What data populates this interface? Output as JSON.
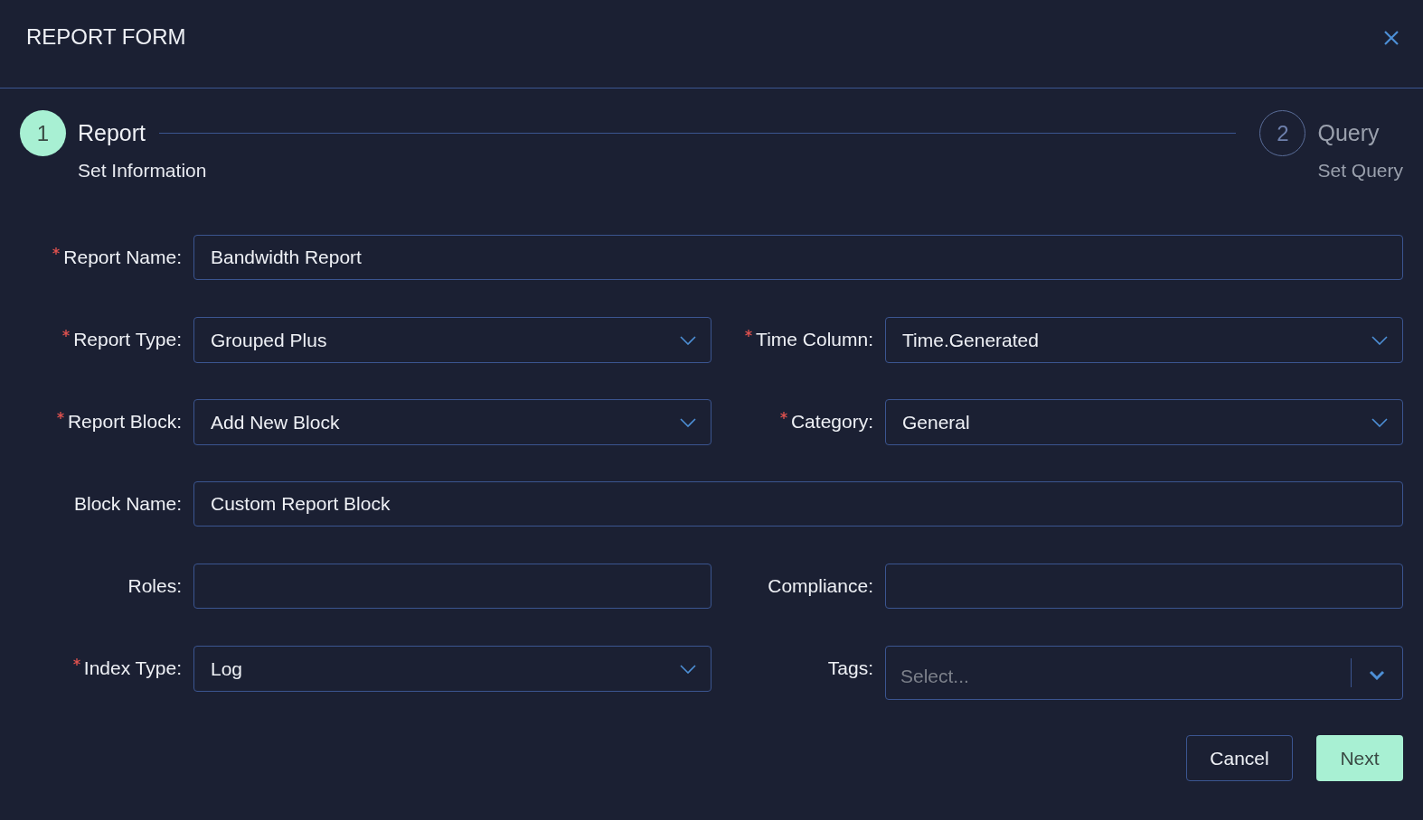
{
  "dialog": {
    "title": "REPORT FORM"
  },
  "steps": [
    {
      "number": "1",
      "title": "Report",
      "subtitle": "Set Information",
      "active": true
    },
    {
      "number": "2",
      "title": "Query",
      "subtitle": "Set Query",
      "active": false
    }
  ],
  "rows": [
    {
      "fields": [
        {
          "label": "Report Name:",
          "required": true,
          "kind": "text",
          "value": "Bandwidth Report"
        }
      ]
    },
    {
      "fields": [
        {
          "label": "Report Type:",
          "required": true,
          "kind": "select",
          "value": "Grouped Plus"
        },
        {
          "label": "Time Column:",
          "required": true,
          "kind": "select",
          "value": "Time.Generated"
        }
      ]
    },
    {
      "fields": [
        {
          "label": "Report Block:",
          "required": true,
          "kind": "select",
          "value": "Add New Block"
        },
        {
          "label": "Category:",
          "required": true,
          "kind": "select",
          "value": "General"
        }
      ]
    },
    {
      "fields": [
        {
          "label": "Block Name:",
          "required": false,
          "kind": "text",
          "value": "Custom Report Block"
        }
      ]
    },
    {
      "fields": [
        {
          "label": "Roles:",
          "required": false,
          "kind": "text"
        },
        {
          "label": "Compliance:",
          "required": false,
          "kind": "text"
        }
      ]
    },
    {
      "fields": [
        {
          "label": "Index Type:",
          "required": true,
          "kind": "select",
          "value": "Log"
        },
        {
          "label": "Tags:",
          "required": false,
          "kind": "multiselect",
          "placeholder": "Select..."
        }
      ]
    }
  ],
  "buttons": [
    {
      "label": "Cancel",
      "kind": "secondary"
    },
    {
      "label": "Next",
      "kind": "primary"
    }
  ]
}
